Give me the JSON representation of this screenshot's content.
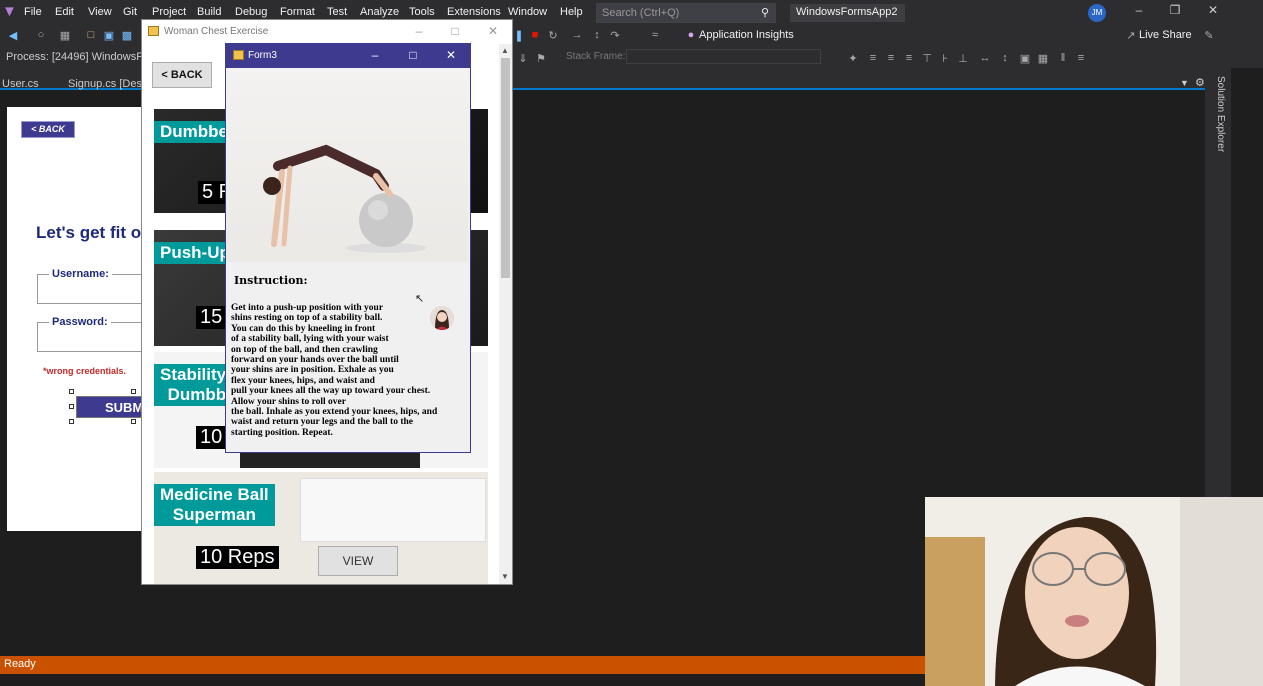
{
  "menubar": {
    "items": [
      "File",
      "Edit",
      "View",
      "Git",
      "Project",
      "Build",
      "Debug",
      "Format",
      "Test",
      "Analyze",
      "Tools",
      "Extensions",
      "Window",
      "Help"
    ],
    "search_placeholder": "Search (Ctrl+Q)",
    "solution_name": "WindowsFormsApp2",
    "user_initials": "JM"
  },
  "toolbar": {
    "app_insights": "Application Insights",
    "live_share": "Live Share"
  },
  "debugbar": {
    "process": "Process:  [24496] WindowsForm",
    "stack_frame": "Stack Frame:"
  },
  "tabs": [
    "User.cs",
    "Signup.cs [Desig"
  ],
  "solution_explorer": "Solution Explorer",
  "designer": {
    "back": "< BACK",
    "heading": "Let's get fit o",
    "username_label": "Username:",
    "password_label": "Password:",
    "error": "*wrong credentials.",
    "submit": "SUBM"
  },
  "wce": {
    "title": "Woman Chest Exercise",
    "back": "< BACK",
    "cards": [
      {
        "title": "Dumbbe",
        "reps": "5 R"
      },
      {
        "title": "Push-Up",
        "reps": "15"
      },
      {
        "title": "Stability\nDumbb",
        "reps": "10"
      },
      {
        "title": "Medicine Ball\nSuperman",
        "reps": "10 Reps",
        "view": "VIEW"
      }
    ]
  },
  "form3": {
    "title": "Form3",
    "instruction_heading": "Instruction:",
    "instruction_text": "Get into a push-up position with your\nshins resting on top of a stability ball.\nYou can do this by kneeling in front\nof a stability ball, lying with your waist\non top of the ball, and then crawling\nforward on your hands over the ball until\nyour shins are in position. Exhale as you\nflex your knees, hips, and waist and\npull your knees all the way up toward your chest.\nAllow your shins to roll over\nthe ball. Inhale as you extend your knees, hips, and\nwaist and return your legs and the ball to the\nstarting position. Repeat."
  },
  "status": {
    "text": "Ready",
    "color": "#ca5100"
  },
  "colors": {
    "accent": "#007acc",
    "form_accent": "#3d3a8f",
    "card_label": "#009a9a"
  }
}
